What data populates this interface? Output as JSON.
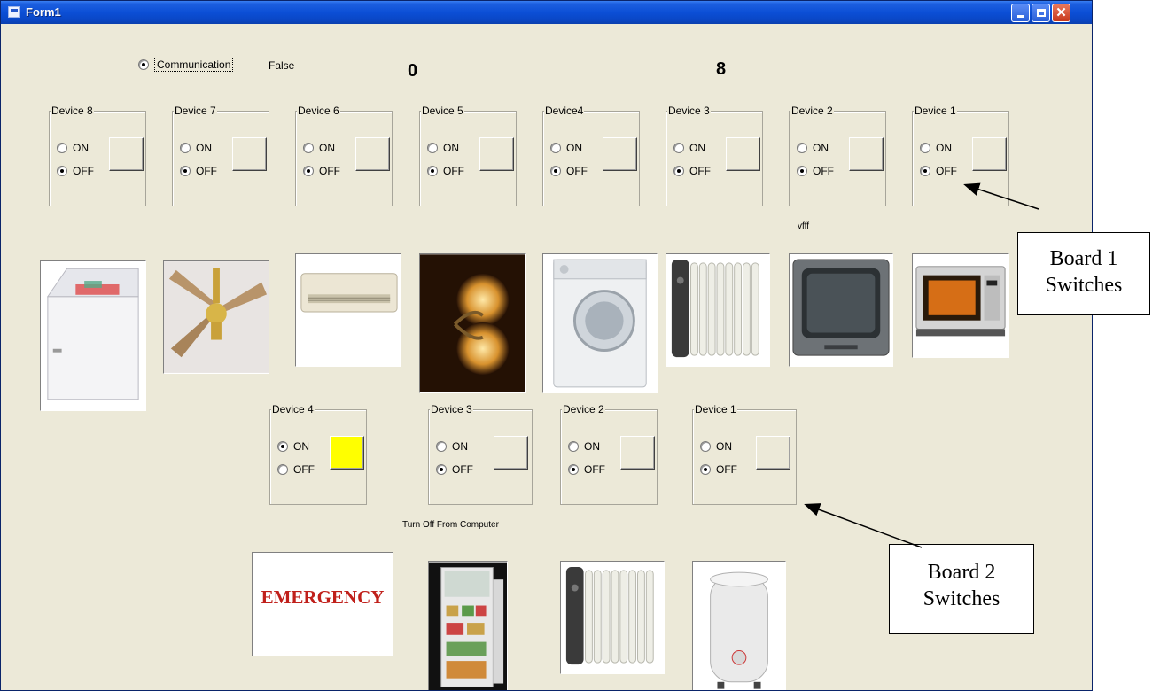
{
  "window": {
    "title": "Form1"
  },
  "communication": {
    "label": "Communication",
    "checked": true,
    "status": "False"
  },
  "counters": {
    "left": "0",
    "right": "8"
  },
  "labels": {
    "vfff": "vfff",
    "turn_off": "Turn Off From Computer"
  },
  "board1": {
    "devices": [
      {
        "label": "Device 8",
        "on_label": "ON",
        "off_label": "OFF",
        "state": "OFF"
      },
      {
        "label": "Device 7",
        "on_label": "ON",
        "off_label": "OFF",
        "state": "OFF"
      },
      {
        "label": "Device 6",
        "on_label": "ON",
        "off_label": "OFF",
        "state": "OFF"
      },
      {
        "label": "Device 5",
        "on_label": "ON",
        "off_label": "OFF",
        "state": "OFF"
      },
      {
        "label": "Device4",
        "on_label": "ON",
        "off_label": "OFF",
        "state": "OFF"
      },
      {
        "label": "Device 3",
        "on_label": "ON",
        "off_label": "OFF",
        "state": "OFF"
      },
      {
        "label": "Device 2",
        "on_label": "ON",
        "off_label": "OFF",
        "state": "OFF"
      },
      {
        "label": "Device 1",
        "on_label": "ON",
        "off_label": "OFF",
        "state": "OFF"
      }
    ],
    "appliances": [
      "freezer-icon",
      "ceiling-fan-icon",
      "air-conditioner-icon",
      "wall-lamp-icon",
      "washing-machine-icon",
      "oil-heater-icon",
      "television-icon",
      "microwave-icon"
    ]
  },
  "board2": {
    "devices": [
      {
        "label": "Device 4",
        "on_label": "ON",
        "off_label": "OFF",
        "state": "ON"
      },
      {
        "label": "Device 3",
        "on_label": "ON",
        "off_label": "OFF",
        "state": "OFF"
      },
      {
        "label": "Device 2",
        "on_label": "ON",
        "off_label": "OFF",
        "state": "OFF"
      },
      {
        "label": "Device 1",
        "on_label": "ON",
        "off_label": "OFF",
        "state": "OFF"
      }
    ],
    "appliances": [
      "emergency-sign",
      "refrigerator-icon",
      "oil-heater-icon",
      "water-heater-icon"
    ],
    "emergency_text": "EMERGENCY"
  },
  "callouts": {
    "board1": [
      "Board 1",
      "Switches"
    ],
    "board2": [
      "Board 2",
      "Switches"
    ]
  },
  "colors": {
    "titlebar": "#0b4fd6",
    "form_bg": "#ece9d8",
    "indicator_on": "#ffff00",
    "emergency": "#c0201b"
  }
}
